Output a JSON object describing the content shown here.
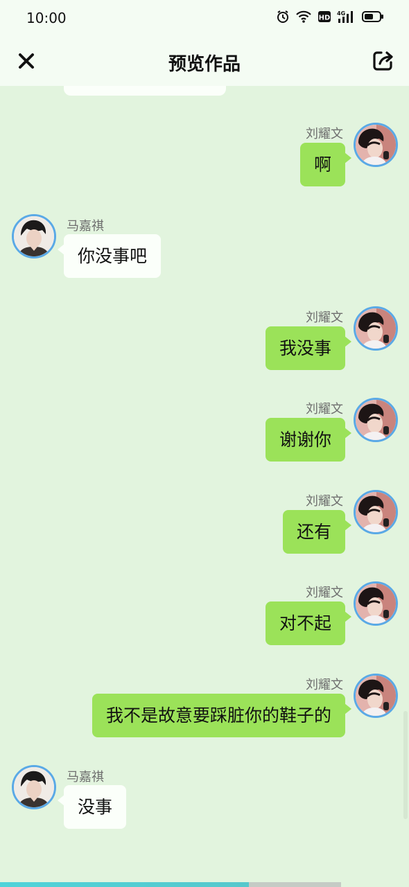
{
  "status_bar": {
    "time": "10:00"
  },
  "header": {
    "title": "预览作品"
  },
  "messages": [
    {
      "side": "right",
      "name": "刘耀文",
      "text": "啊"
    },
    {
      "side": "left",
      "name": "马嘉祺",
      "text": "你没事吧"
    },
    {
      "side": "right",
      "name": "刘耀文",
      "text": "我没事"
    },
    {
      "side": "right",
      "name": "刘耀文",
      "text": "谢谢你"
    },
    {
      "side": "right",
      "name": "刘耀文",
      "text": "还有"
    },
    {
      "side": "right",
      "name": "刘耀文",
      "text": "对不起"
    },
    {
      "side": "right",
      "name": "刘耀文",
      "text": "我不是故意要踩脏你的鞋子的"
    },
    {
      "side": "left",
      "name": "马嘉祺",
      "text": "没事"
    }
  ],
  "progress": {
    "fraction": 0.73
  },
  "colors": {
    "background": "#e2f4de",
    "right_bubble": "#9be259",
    "left_bubble": "#fbfffa",
    "avatar_ring": "#5aa9e6"
  },
  "icons": {
    "close": "close-icon",
    "share": "share-icon",
    "alarm": "alarm-icon",
    "wifi": "wifi-icon",
    "hd": "hd-icon",
    "signal": "signal-4g-icon",
    "battery": "battery-icon"
  }
}
